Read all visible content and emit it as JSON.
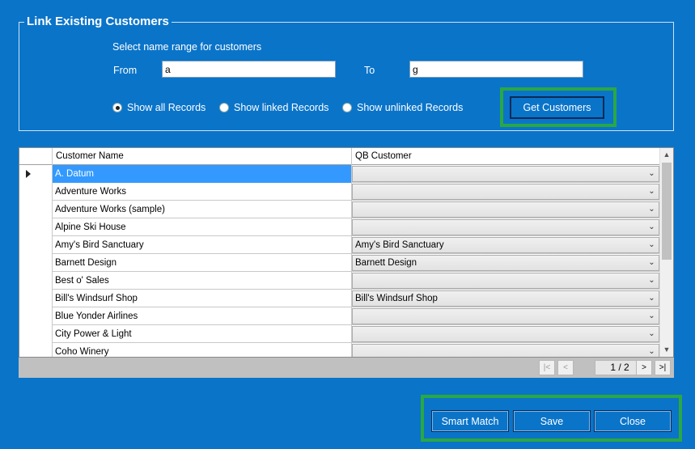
{
  "panel": {
    "title": "Link Existing Customers",
    "range_label": "Select name range for customers",
    "from_label": "From",
    "from_value": "a",
    "to_label": "To",
    "to_value": "g",
    "radios": [
      {
        "label": "Show all Records",
        "checked": true
      },
      {
        "label": "Show linked Records",
        "checked": false
      },
      {
        "label": "Show unlinked Records",
        "checked": false
      }
    ],
    "get_customers_label": "Get Customers"
  },
  "grid": {
    "columns": [
      "Customer Name",
      "QB Customer"
    ],
    "rows": [
      {
        "name": "A. Datum",
        "qb": ""
      },
      {
        "name": "Adventure Works",
        "qb": ""
      },
      {
        "name": "Adventure Works (sample)",
        "qb": ""
      },
      {
        "name": "Alpine Ski House",
        "qb": ""
      },
      {
        "name": "Amy's Bird Sanctuary",
        "qb": "Amy's Bird Sanctuary"
      },
      {
        "name": "Barnett Design",
        "qb": "Barnett Design"
      },
      {
        "name": "Best o' Sales",
        "qb": ""
      },
      {
        "name": "Bill's Windsurf Shop",
        "qb": "Bill's Windsurf Shop"
      },
      {
        "name": "Blue Yonder Airlines",
        "qb": ""
      },
      {
        "name": "City Power & Light",
        "qb": ""
      },
      {
        "name": "Coho Winery",
        "qb": ""
      }
    ],
    "selected_index": 0
  },
  "pager": {
    "page_info": "1 / 2",
    "first": "|<",
    "prev": "<",
    "next": ">",
    "last": ">|"
  },
  "footer": {
    "smart_match_label": "Smart Match",
    "save_label": "Save",
    "close_label": "Close"
  },
  "colors": {
    "background": "#0a74c9",
    "highlight": "#2aa843",
    "selection": "#3399ff"
  }
}
